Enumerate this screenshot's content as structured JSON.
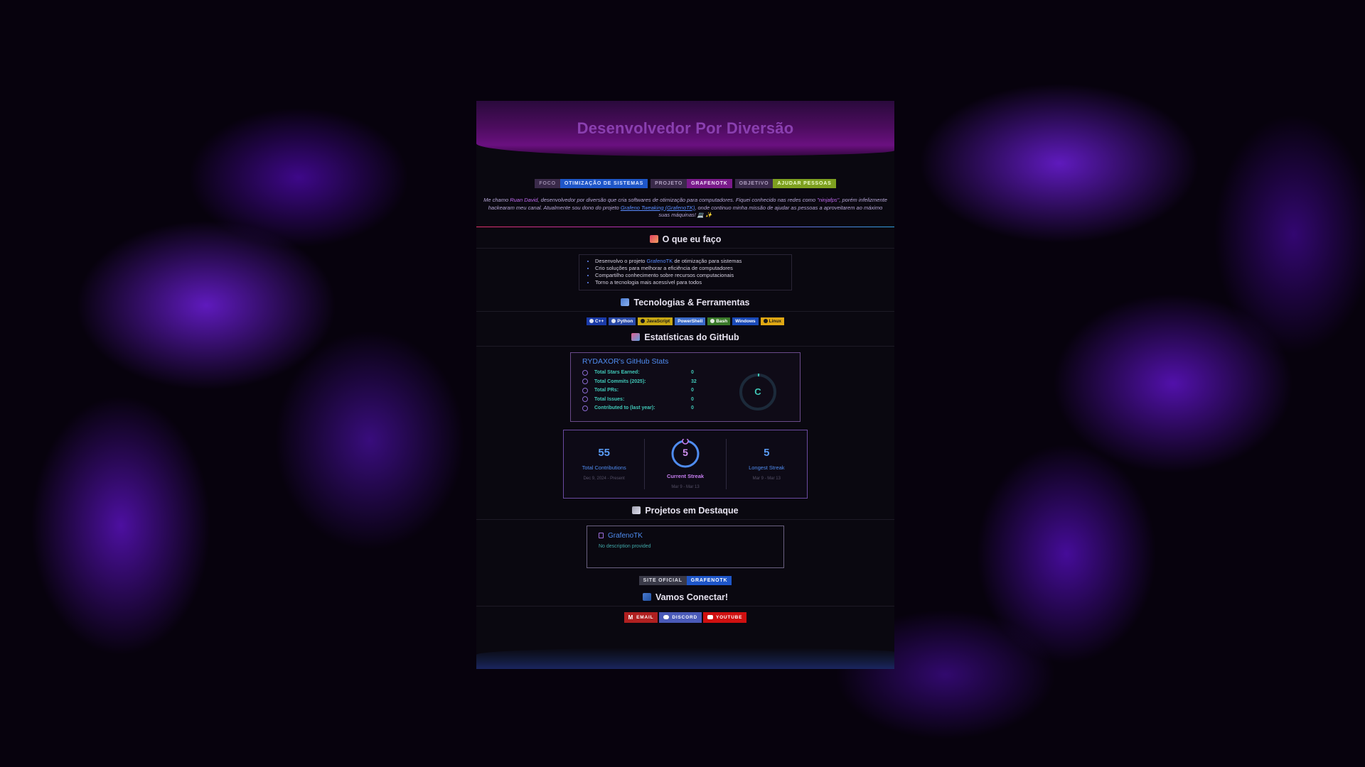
{
  "hero": {
    "title": "Desenvolvedor Por Diversão"
  },
  "badges": [
    {
      "left": "FOCO",
      "right": "OTIMIZAÇÃO DE SISTEMAS",
      "left_color": "#3a2a4a",
      "right_color": "#1e56c8"
    },
    {
      "left": "PROJETO",
      "right": "GRAFENOTK",
      "left_color": "#3a2a4a",
      "right_color": "#7a1a8a"
    },
    {
      "left": "OBJETIVO",
      "right": "AJUDAR PESSOAS",
      "left_color": "#3a2a4a",
      "right_color": "#7ea020"
    }
  ],
  "intro": {
    "p1": "Me chamo ",
    "name": "Ruan David",
    "p2": ", desenvolvedor por diversão que cria softwares de otimização para computadores. Fiquei conhecido nas redes como",
    "handle": "\"ninjafps\"",
    "p3": ", porém infelizmente hackearam meu canal. Atualmente sou dono do projeto ",
    "link": "Grafeno Tweaking (GrafenoTK)",
    "p4": ", onde continuo minha missão de ajudar as pessoas a aproveitarem ao máximo suas máquinas! 💻 ✨"
  },
  "what_i_do": {
    "title": "O que eu faço",
    "items": [
      {
        "pre": "Desenvolvo o projeto ",
        "link": "GrafenoTK",
        "post": " de otimização para sistemas"
      },
      {
        "pre": "Crio soluções para melhorar a eficiência de computadores",
        "link": "",
        "post": ""
      },
      {
        "pre": "Compartilho conhecimento sobre recursos computacionais",
        "link": "",
        "post": ""
      },
      {
        "pre": "Torno a tecnologia mais acessível para todos",
        "link": "",
        "post": ""
      }
    ]
  },
  "tech": {
    "title": "Tecnologias & Ferramentas",
    "items": [
      {
        "label": "C++",
        "color": "#1a3aa8",
        "text_color": "#ffffff"
      },
      {
        "label": "Python",
        "color": "#2a4aa8",
        "text_color": "#ffffff"
      },
      {
        "label": "JavaScript",
        "color": "#c8a814",
        "text_color": "#1a1a1a"
      },
      {
        "label": "PowerShell",
        "color": "#3a6ac8",
        "text_color": "#ffffff"
      },
      {
        "label": "Bash",
        "color": "#3a7a2a",
        "text_color": "#ffffff"
      },
      {
        "label": "Windows",
        "color": "#1a4ab8",
        "text_color": "#ffffff"
      },
      {
        "label": "Linux",
        "color": "#e0a814",
        "text_color": "#1a1a1a"
      }
    ]
  },
  "github": {
    "title": "Estatísticas do GitHub",
    "stats_title": "RYDAXOR's GitHub Stats",
    "rows": [
      {
        "label": "Total Stars Earned:",
        "value": "0"
      },
      {
        "label": "Total Commits (2025):",
        "value": "32"
      },
      {
        "label": "Total PRs:",
        "value": "0"
      },
      {
        "label": "Total Issues:",
        "value": "0"
      },
      {
        "label": "Contributed to (last year):",
        "value": "0"
      }
    ],
    "grade": "C"
  },
  "streak": {
    "total": {
      "value": "55",
      "label": "Total Contributions",
      "range": "Dec 9, 2024 - Present"
    },
    "current": {
      "value": "5",
      "label": "Current Streak",
      "range": "Mar 9 - Mar 13"
    },
    "longest": {
      "value": "5",
      "label": "Longest Streak",
      "range": "Mar 9 - Mar 13"
    }
  },
  "projects": {
    "title": "Projetos em Destaque",
    "repo_name": "GrafenoTK",
    "repo_desc": "No description provided",
    "site_left": "SITE OFICIAL",
    "site_right": "GRAFENOTK"
  },
  "connect": {
    "title": "Vamos Conectar!",
    "items": [
      {
        "label": "EMAIL",
        "color": "#b02020"
      },
      {
        "label": "DISCORD",
        "color": "#4a5ab8"
      },
      {
        "label": "YOUTUBE",
        "color": "#d01010"
      }
    ]
  }
}
